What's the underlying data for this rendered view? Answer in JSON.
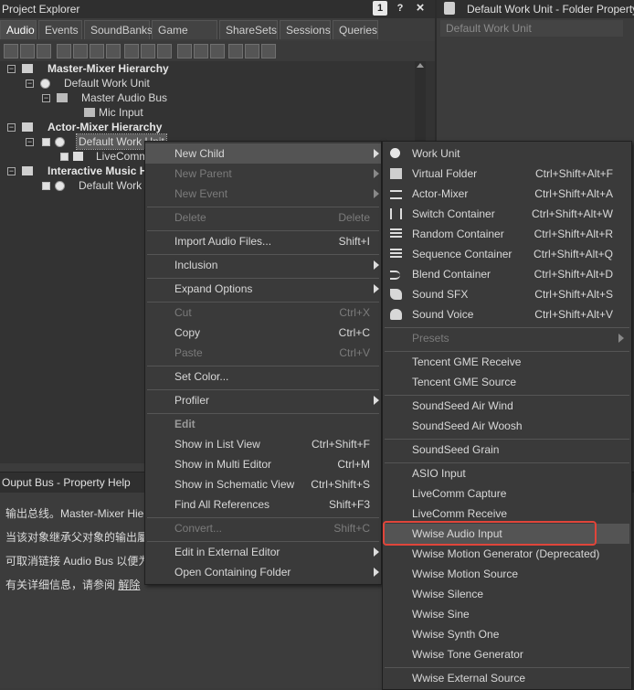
{
  "project_explorer": {
    "title": "Project Explorer",
    "title_icons": [
      "1",
      "?",
      "×"
    ],
    "tabs": [
      "Audio",
      "Events",
      "SoundBanks",
      "Game Syncs",
      "ShareSets",
      "Sessions",
      "Queries"
    ],
    "tree": [
      {
        "label": "Master-Mixer Hierarchy"
      },
      {
        "label": "Default Work Unit"
      },
      {
        "label": "Master Audio Bus"
      },
      {
        "label": "Mic Input"
      },
      {
        "label": "Actor-Mixer Hierarchy"
      },
      {
        "label": "Default Work Unit"
      },
      {
        "label": "LiveComm"
      },
      {
        "label": "Interactive Music H"
      },
      {
        "label": "Default Work U"
      }
    ]
  },
  "property_editor": {
    "title": "Default Work Unit - Folder Property Ec",
    "subtitle": "Default Work Unit"
  },
  "bottom_panel": {
    "title": "Ouput Bus - Property Help",
    "lines": [
      "输出总线。Master-Mixer Hier",
      "当该对象继承父对象的输出屬",
      "可取消链接 Audio Bus 以便为",
      "有关详细信息，请参阅"
    ],
    "link_text": "解除",
    "link_suffix": "…"
  },
  "context_menu": {
    "items": [
      {
        "label": "New Child",
        "shortcut": "",
        "submenu": true,
        "disabled": false
      },
      {
        "label": "New Parent",
        "shortcut": "",
        "submenu": true,
        "disabled": true
      },
      {
        "label": "New Event",
        "shortcut": "",
        "submenu": true,
        "disabled": true
      },
      {
        "label": "Delete",
        "shortcut": "Delete",
        "submenu": false,
        "disabled": true
      },
      {
        "label": "Import Audio Files...",
        "shortcut": "Shift+I",
        "submenu": false,
        "disabled": false
      },
      {
        "label": "Inclusion",
        "shortcut": "",
        "submenu": true,
        "disabled": false
      },
      {
        "label": "Expand Options",
        "shortcut": "",
        "submenu": true,
        "disabled": false
      },
      {
        "label": "Cut",
        "shortcut": "Ctrl+X",
        "submenu": false,
        "disabled": true
      },
      {
        "label": "Copy",
        "shortcut": "Ctrl+C",
        "submenu": false,
        "disabled": false
      },
      {
        "label": "Paste",
        "shortcut": "Ctrl+V",
        "submenu": false,
        "disabled": true
      },
      {
        "label": "Set Color...",
        "shortcut": "",
        "submenu": false,
        "disabled": false
      },
      {
        "label": "Profiler",
        "shortcut": "",
        "submenu": true,
        "disabled": false
      },
      {
        "label": "Edit",
        "shortcut": "",
        "submenu": false,
        "disabled": false,
        "header": true
      },
      {
        "label": "Show in List View",
        "shortcut": "Ctrl+Shift+F",
        "submenu": false,
        "disabled": false
      },
      {
        "label": "Show in Multi Editor",
        "shortcut": "Ctrl+M",
        "submenu": false,
        "disabled": false
      },
      {
        "label": "Show in Schematic View",
        "shortcut": "Ctrl+Shift+S",
        "submenu": false,
        "disabled": false
      },
      {
        "label": "Find All References",
        "shortcut": "Shift+F3",
        "submenu": false,
        "disabled": false
      },
      {
        "label": "Convert...",
        "shortcut": "Shift+C",
        "submenu": false,
        "disabled": true
      },
      {
        "label": "Edit in External Editor",
        "shortcut": "",
        "submenu": true,
        "disabled": false
      },
      {
        "label": "Open Containing Folder",
        "shortcut": "",
        "submenu": true,
        "disabled": false
      }
    ]
  },
  "submenu": {
    "items": [
      {
        "label": "Work Unit",
        "shortcut": "",
        "icon": "work-unit-icon"
      },
      {
        "label": "Virtual Folder",
        "shortcut": "Ctrl+Shift+Alt+F",
        "icon": "folder-icon"
      },
      {
        "label": "Actor-Mixer",
        "shortcut": "Ctrl+Shift+Alt+A",
        "icon": "actor-mixer-icon"
      },
      {
        "label": "Switch Container",
        "shortcut": "Ctrl+Shift+Alt+W",
        "icon": "switch-container-icon"
      },
      {
        "label": "Random Container",
        "shortcut": "Ctrl+Shift+Alt+R",
        "icon": "random-container-icon"
      },
      {
        "label": "Sequence Container",
        "shortcut": "Ctrl+Shift+Alt+Q",
        "icon": "sequence-container-icon"
      },
      {
        "label": "Blend Container",
        "shortcut": "Ctrl+Shift+Alt+D",
        "icon": "blend-container-icon"
      },
      {
        "label": "Sound SFX",
        "shortcut": "Ctrl+Shift+Alt+S",
        "icon": "sound-sfx-icon"
      },
      {
        "label": "Sound Voice",
        "shortcut": "Ctrl+Shift+Alt+V",
        "icon": "sound-voice-icon"
      },
      {
        "label": "Presets",
        "shortcut": "",
        "disabled": true,
        "submenu": true
      },
      {
        "label": "Tencent GME Receive",
        "shortcut": ""
      },
      {
        "label": "Tencent GME Source",
        "shortcut": ""
      },
      {
        "label": "SoundSeed Air Wind",
        "shortcut": ""
      },
      {
        "label": "SoundSeed Air Woosh",
        "shortcut": ""
      },
      {
        "label": "SoundSeed Grain",
        "shortcut": ""
      },
      {
        "label": "ASIO Input",
        "shortcut": ""
      },
      {
        "label": "LiveComm Capture",
        "shortcut": ""
      },
      {
        "label": "LiveComm Receive",
        "shortcut": ""
      },
      {
        "label": "Wwise Audio Input",
        "shortcut": "",
        "highlighted": true
      },
      {
        "label": "Wwise Motion Generator (Deprecated)",
        "shortcut": ""
      },
      {
        "label": "Wwise Motion Source",
        "shortcut": ""
      },
      {
        "label": "Wwise Silence",
        "shortcut": ""
      },
      {
        "label": "Wwise Sine",
        "shortcut": ""
      },
      {
        "label": "Wwise Synth One",
        "shortcut": ""
      },
      {
        "label": "Wwise Tone Generator",
        "shortcut": ""
      },
      {
        "label": "Wwise External Source",
        "shortcut": ""
      }
    ]
  },
  "colors": {
    "highlight_outline": "#e0453a"
  }
}
